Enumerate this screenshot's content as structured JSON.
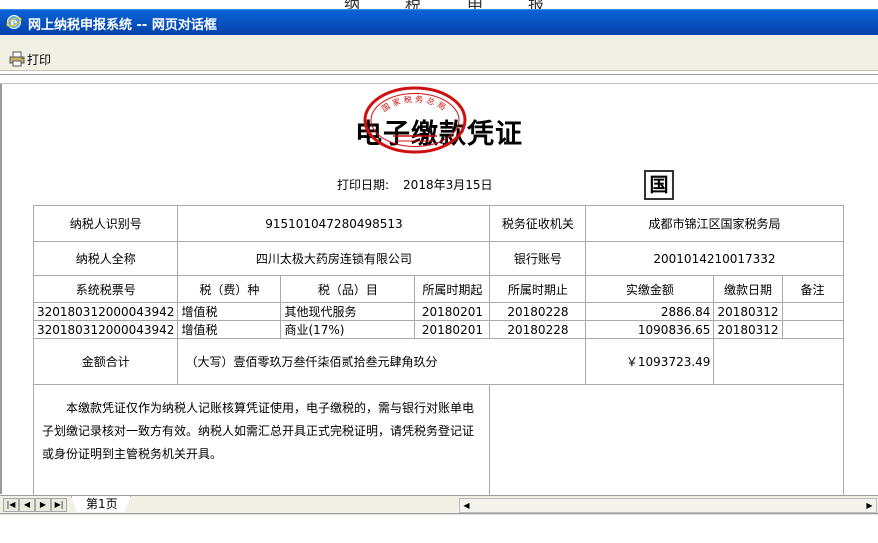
{
  "background_text": [
    "纳",
    "税",
    "申",
    "报"
  ],
  "window": {
    "title": "网上纳税申报系统 -- 网页对话框"
  },
  "toolbar": {
    "print_label": "打印"
  },
  "document": {
    "title": "电子缴款凭证",
    "print_date_label": "打印日期:",
    "print_date": "2018年3月15日",
    "mark_char": "国"
  },
  "stamp": {
    "text": "国家税务总局"
  },
  "info": {
    "taxpayer_id_label": "纳税人识别号",
    "taxpayer_id": "915101047280498513",
    "tax_authority_label": "税务征收机关",
    "tax_authority": "成都市锦江区国家税务局",
    "taxpayer_name_label": "纳税人全称",
    "taxpayer_name": "四川太极大药房连锁有限公司",
    "bank_account_label": "银行账号",
    "bank_account": "2001014210017332"
  },
  "table": {
    "headers": [
      "系统税票号",
      "税（费）种",
      "税（品）目",
      "所属时期起",
      "所属时期止",
      "实缴金额",
      "缴款日期",
      "备注"
    ],
    "rows": [
      [
        "320180312000043942",
        "增值税",
        "其他现代服务",
        "20180201",
        "20180228",
        "2886.84",
        "20180312",
        ""
      ],
      [
        "320180312000043942",
        "增值税",
        "商业(17%)",
        "20180201",
        "20180228",
        "1090836.65",
        "20180312",
        ""
      ]
    ]
  },
  "total": {
    "label": "金额合计",
    "in_words": "（大写）壹佰零玖万叁仟柒佰贰拾叁元肆角玖分",
    "amount": "￥1093723.49"
  },
  "notice": "本缴款凭证仅作为纳税人记账核算凭证使用，电子缴税的，需与银行对账单电子划缴记录核对一致方有效。纳税人如需汇总开具正式完税证明，请凭税务登记证或身份证明到主管税务机关开具。",
  "pager": {
    "first_label": "|◀",
    "prev_label": "◀",
    "next_label": "▶",
    "last_label": "▶|",
    "tab_label": "第1页"
  },
  "colors": {
    "title_bar": "#0a5bd3",
    "stamp_red": "#d01010",
    "toolbar_bg": "#f2efe4"
  }
}
